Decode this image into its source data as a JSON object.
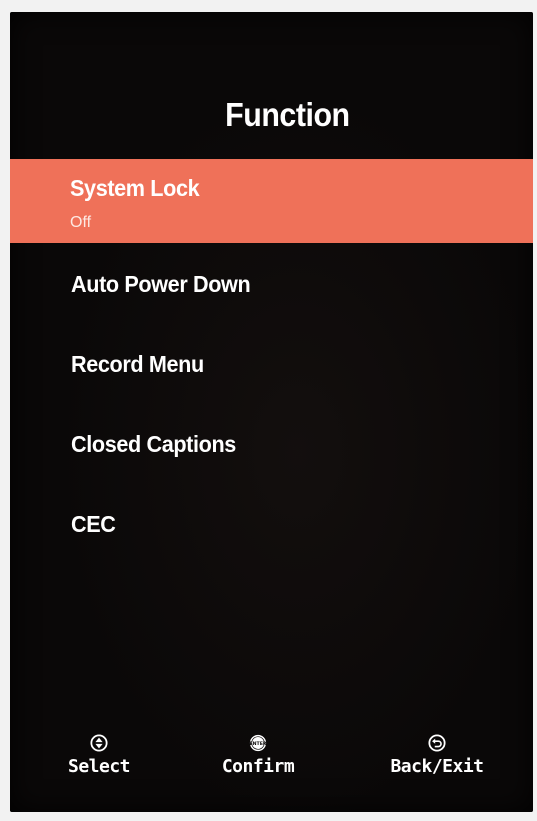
{
  "screen": {
    "title": "Function"
  },
  "menu": {
    "items": [
      {
        "label": "System Lock",
        "value": "Off",
        "selected": true
      },
      {
        "label": "Auto Power Down"
      },
      {
        "label": "Record Menu"
      },
      {
        "label": "Closed Captions"
      },
      {
        "label": "CEC"
      }
    ]
  },
  "footer": {
    "hints": [
      {
        "icon": "up-down-arrows-icon",
        "label": "Select"
      },
      {
        "icon": "enter-icon",
        "label": "Confirm",
        "icon_text": "ENTER"
      },
      {
        "icon": "back-return-icon",
        "label": "Back/Exit"
      }
    ]
  },
  "colors": {
    "background": "#0a0808",
    "highlight": "#ef7159",
    "text": "#ffffff"
  }
}
